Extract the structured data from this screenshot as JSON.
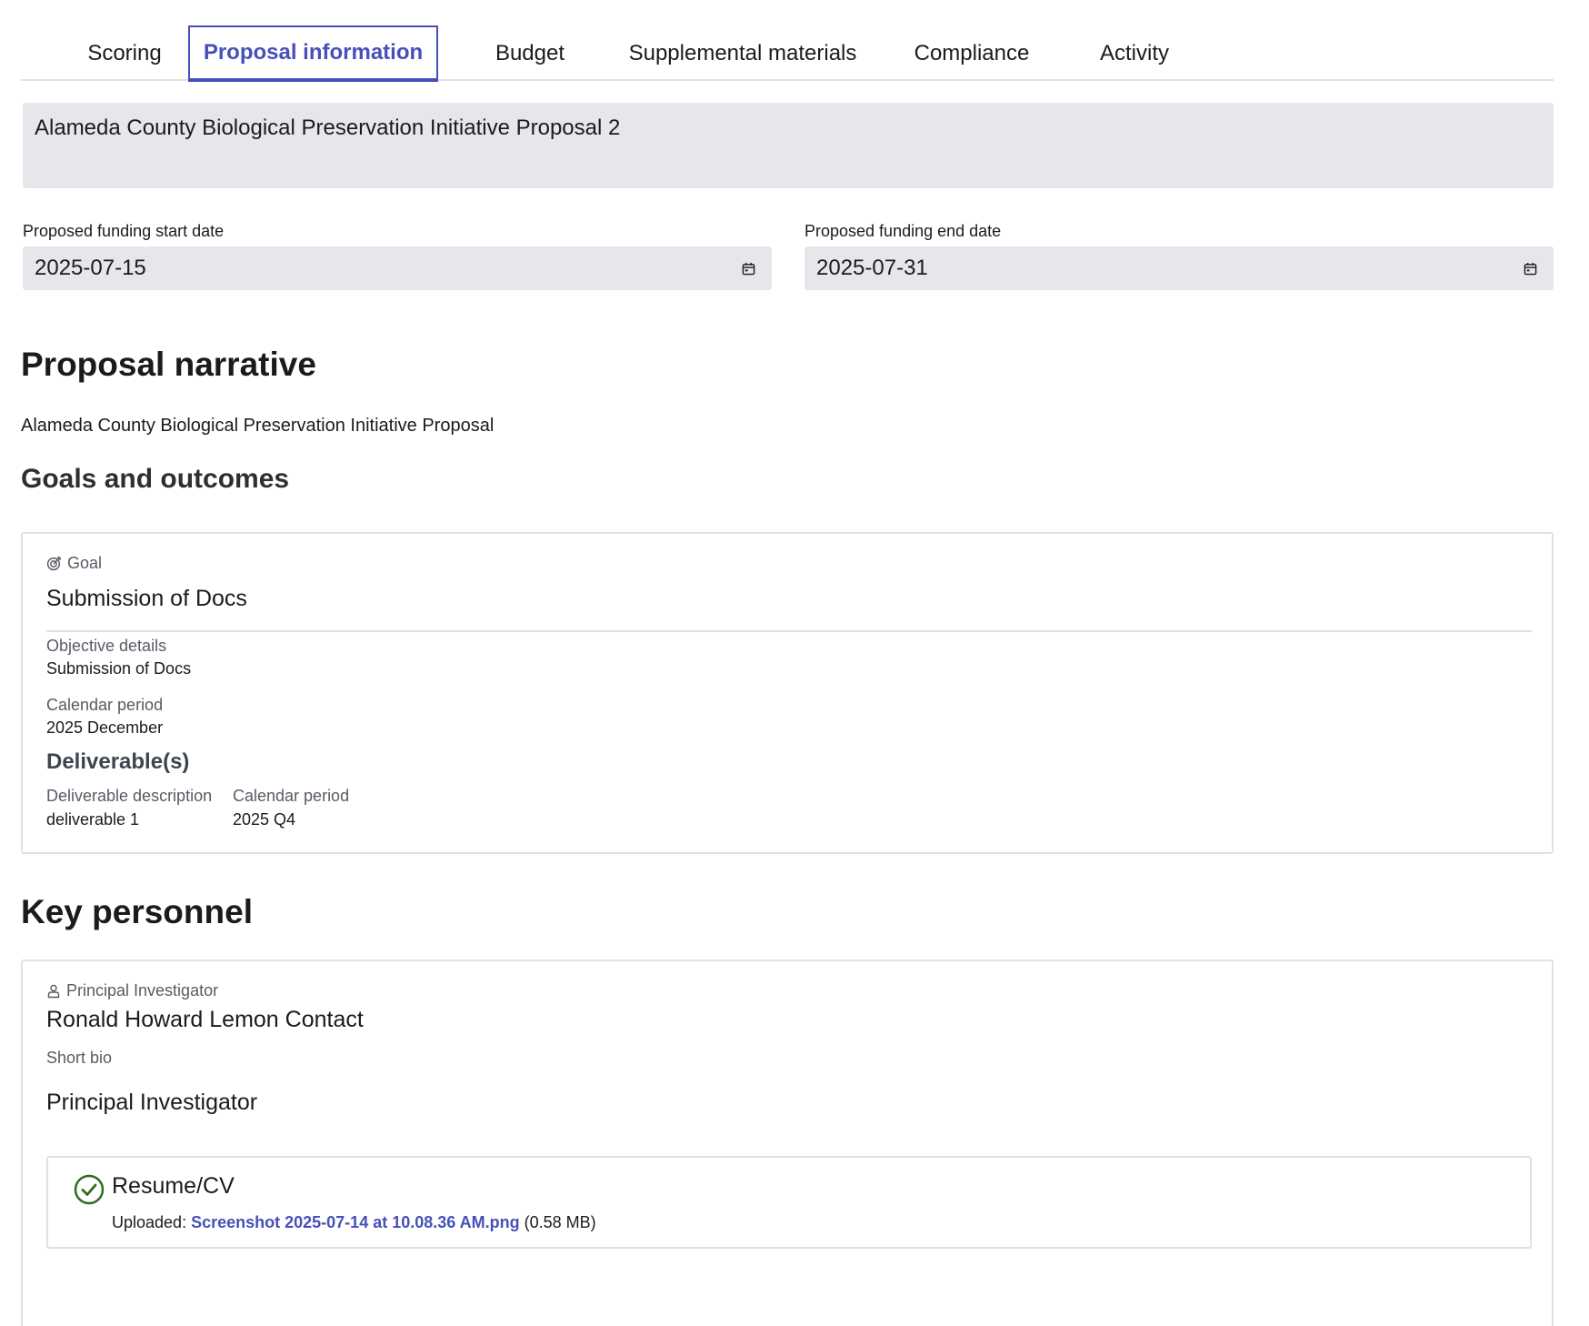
{
  "tabs": [
    {
      "label": "Scoring"
    },
    {
      "label": "Proposal information"
    },
    {
      "label": "Budget"
    },
    {
      "label": "Supplemental materials"
    },
    {
      "label": "Compliance"
    },
    {
      "label": "Activity"
    }
  ],
  "active_tab": "Proposal information",
  "proposal": {
    "title": "Alameda County Biological Preservation Initiative Proposal 2",
    "start_date_label": "Proposed funding start date",
    "start_date": "2025-07-15",
    "end_date_label": "Proposed funding end date",
    "end_date": "2025-07-31"
  },
  "narrative": {
    "heading": "Proposal narrative",
    "text": "Alameda County Biological Preservation Initiative Proposal"
  },
  "goals": {
    "heading": "Goals and outcomes",
    "items": [
      {
        "kind_label": "Goal",
        "kind_icon": "target-icon",
        "title": "Submission of Docs",
        "objective_label": "Objective details",
        "objective": "Submission of Docs",
        "calendar_label": "Calendar period",
        "calendar": "2025 December",
        "deliverables_heading": "Deliverable(s)",
        "deliverable_desc_label": "Deliverable description",
        "deliverable_cal_label": "Calendar period",
        "deliverables": [
          {
            "description": "deliverable 1",
            "period": "2025 Q4"
          }
        ]
      }
    ]
  },
  "personnel": {
    "heading": "Key personnel",
    "items": [
      {
        "role": "Principal Investigator",
        "role_icon": "person-icon",
        "name": "Ronald Howard Lemon Contact",
        "bio_label": "Short bio",
        "bio": "Principal Investigator",
        "file": {
          "title": "Resume/CV",
          "uploaded_prefix": "Uploaded:",
          "filename": "Screenshot 2025-07-14 at 10.08.36 AM.png",
          "size": "(0.58 MB)",
          "status_icon": "check-circle-icon"
        }
      }
    ]
  },
  "colors": {
    "accent": "#4650b8",
    "field_bg": "#e6e7ea",
    "border": "#dfe1e2",
    "success": "#2e6b1f"
  }
}
